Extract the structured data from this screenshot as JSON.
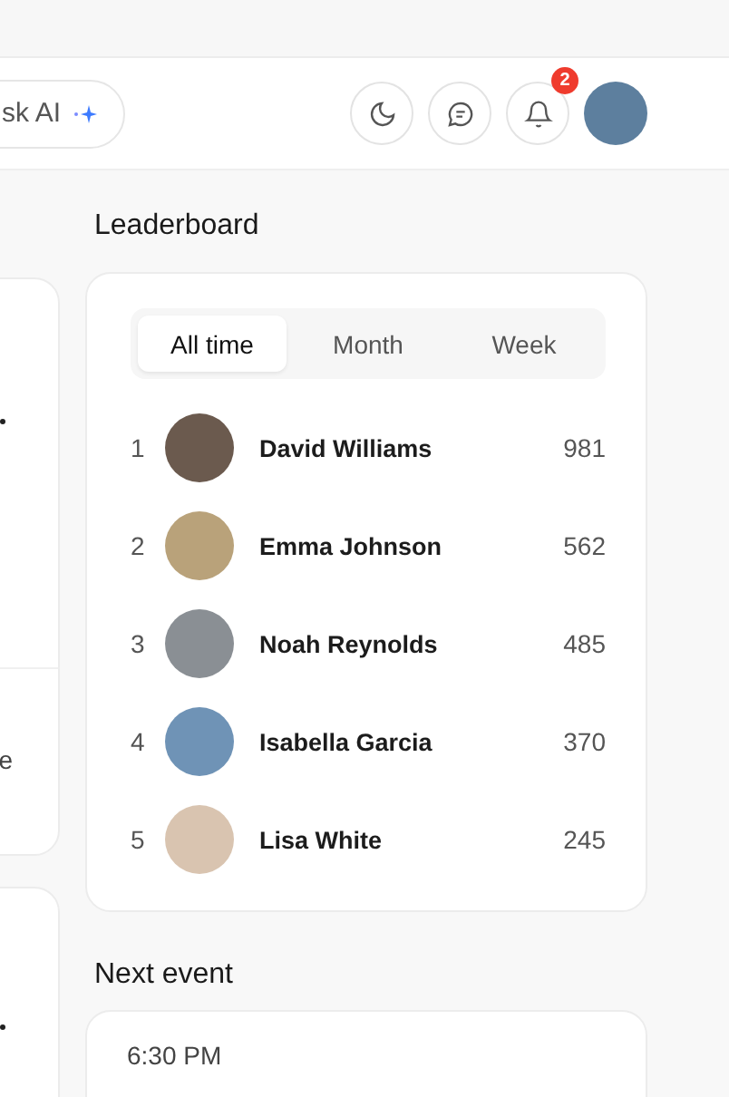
{
  "header": {
    "ask_ai": {
      "label": "sk AI"
    },
    "notifications": {
      "count": "2"
    }
  },
  "left_fragments": [
    "e"
  ],
  "leaderboard": {
    "title": "Leaderboard",
    "tabs": [
      {
        "label": "All time",
        "selected": true
      },
      {
        "label": "Month",
        "selected": false
      },
      {
        "label": "Week",
        "selected": false
      }
    ],
    "rows": [
      {
        "rank": "1",
        "name": "David Williams",
        "score": "981"
      },
      {
        "rank": "2",
        "name": "Emma Johnson",
        "score": "562"
      },
      {
        "rank": "3",
        "name": "Noah Reynolds",
        "score": "485"
      },
      {
        "rank": "4",
        "name": "Isabella Garcia",
        "score": "370"
      },
      {
        "rank": "5",
        "name": "Lisa White",
        "score": "245"
      }
    ]
  },
  "next_event": {
    "title": "Next event",
    "time": "6:30 PM"
  }
}
